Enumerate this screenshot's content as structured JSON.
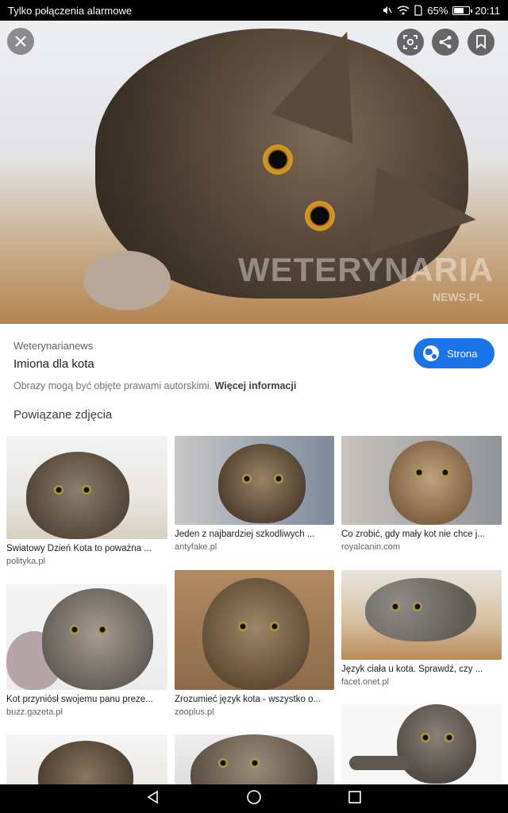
{
  "status": {
    "carrier": "Tylko połączenia alarmowe",
    "battery_percent": "65%",
    "battery_level": 0.65,
    "time": "20:11"
  },
  "hero": {
    "watermark": "WETERYNARIA",
    "watermark_sub": "NEWS.PL"
  },
  "info": {
    "source": "Weterynarianews",
    "title": "Imiona dla kota",
    "site_button": "Strona",
    "copyright_text": "Obrazy mogą być objęte prawami autorskimi.",
    "copyright_link": "Więcej informacji",
    "related_heading": "Powiązane zdjęcia"
  },
  "related": [
    {
      "caption": "Światowy Dzień Kota to poważna ...",
      "domain": "polityka.pl"
    },
    {
      "caption": "Jeden z najbardziej szkodliwych ...",
      "domain": "antyfake.pl"
    },
    {
      "caption": "Co zrobić, gdy mały kot nie chce j...",
      "domain": "royalcanin.com"
    },
    {
      "caption": "Kot przyniósł swojemu panu preze...",
      "domain": "buzz.gazeta.pl"
    },
    {
      "caption": "Zrozumieć język kota - wszystko o...",
      "domain": "zooplus.pl"
    },
    {
      "caption": "Język ciała u kota. Sprawdź, czy ...",
      "domain": "facet.onet.pl"
    },
    {
      "caption": "",
      "domain": ""
    },
    {
      "caption": "",
      "domain": ""
    },
    {
      "caption": "",
      "domain": ""
    }
  ],
  "icons": {
    "close": "close-icon",
    "lens": "lens-icon",
    "share": "share-icon",
    "save": "bookmark-icon",
    "back": "back-icon",
    "home": "home-icon",
    "recents": "recents-icon"
  },
  "colors": {
    "accent": "#1a73e8"
  }
}
